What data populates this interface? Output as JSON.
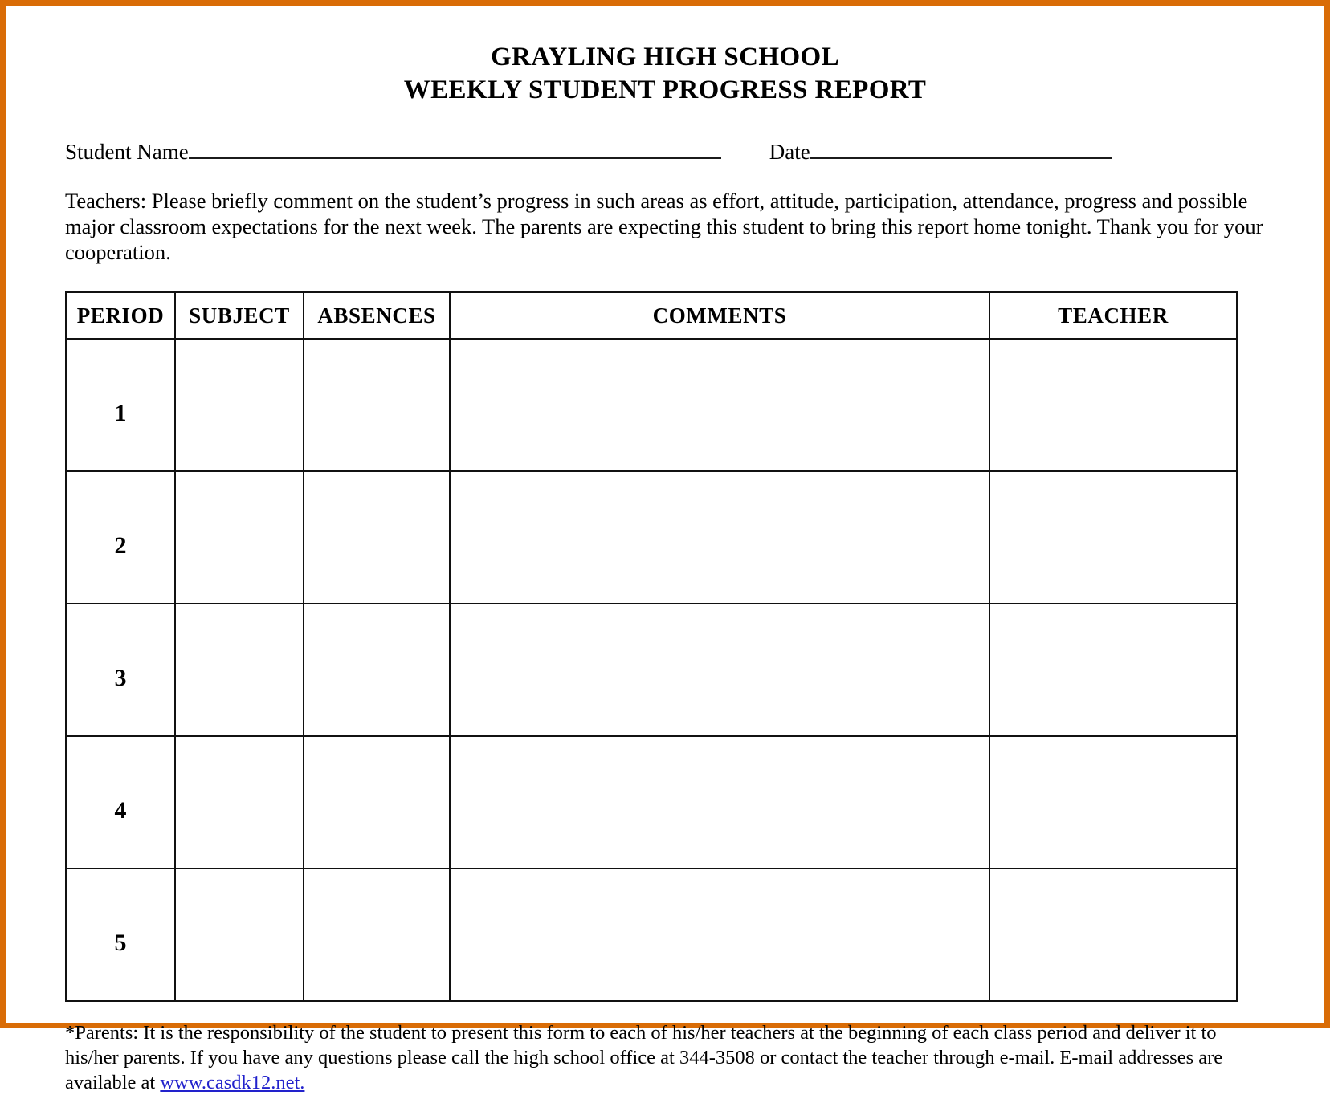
{
  "page": {
    "border_color": "#d96c06",
    "background_color": "#ffffff",
    "text_color": "#000000",
    "link_color": "#2222cc"
  },
  "header": {
    "title_line_1": "GRAYLING HIGH SCHOOL",
    "title_line_2": "WEEKLY STUDENT PROGRESS REPORT"
  },
  "fields": {
    "student_name_label": "Student Name",
    "student_name_value": "",
    "date_label": "Date",
    "date_value": ""
  },
  "instructions": {
    "text": "Teachers: Please briefly comment on the student’s progress in such areas as effort, attitude, participation, attendance, progress and possible major classroom expectations for the next week.  The parents are expecting this student to bring this report home tonight.  Thank you for your cooperation."
  },
  "table": {
    "columns": [
      "PERIOD",
      "SUBJECT",
      "ABSENCES",
      "COMMENTS",
      "TEACHER"
    ],
    "rows": [
      {
        "period": "1",
        "subject": "",
        "absences": "",
        "comments": "",
        "teacher": ""
      },
      {
        "period": "2",
        "subject": "",
        "absences": "",
        "comments": "",
        "teacher": ""
      },
      {
        "period": "3",
        "subject": "",
        "absences": "",
        "comments": "",
        "teacher": ""
      },
      {
        "period": "4",
        "subject": "",
        "absences": "",
        "comments": "",
        "teacher": ""
      },
      {
        "period": "5",
        "subject": "",
        "absences": "",
        "comments": "",
        "teacher": ""
      }
    ]
  },
  "footer": {
    "paragraph_part_1": "*Parents: It is the responsibility of the student to present this form to each of his/her teachers at the beginning of each class period and deliver it to his/her parents. If you have any questions please call the high school office at 344-3508 or contact the teacher through e-mail. E-mail addresses are available at ",
    "link_text": "www.casdk12.net.",
    "phone": "344-3508"
  }
}
